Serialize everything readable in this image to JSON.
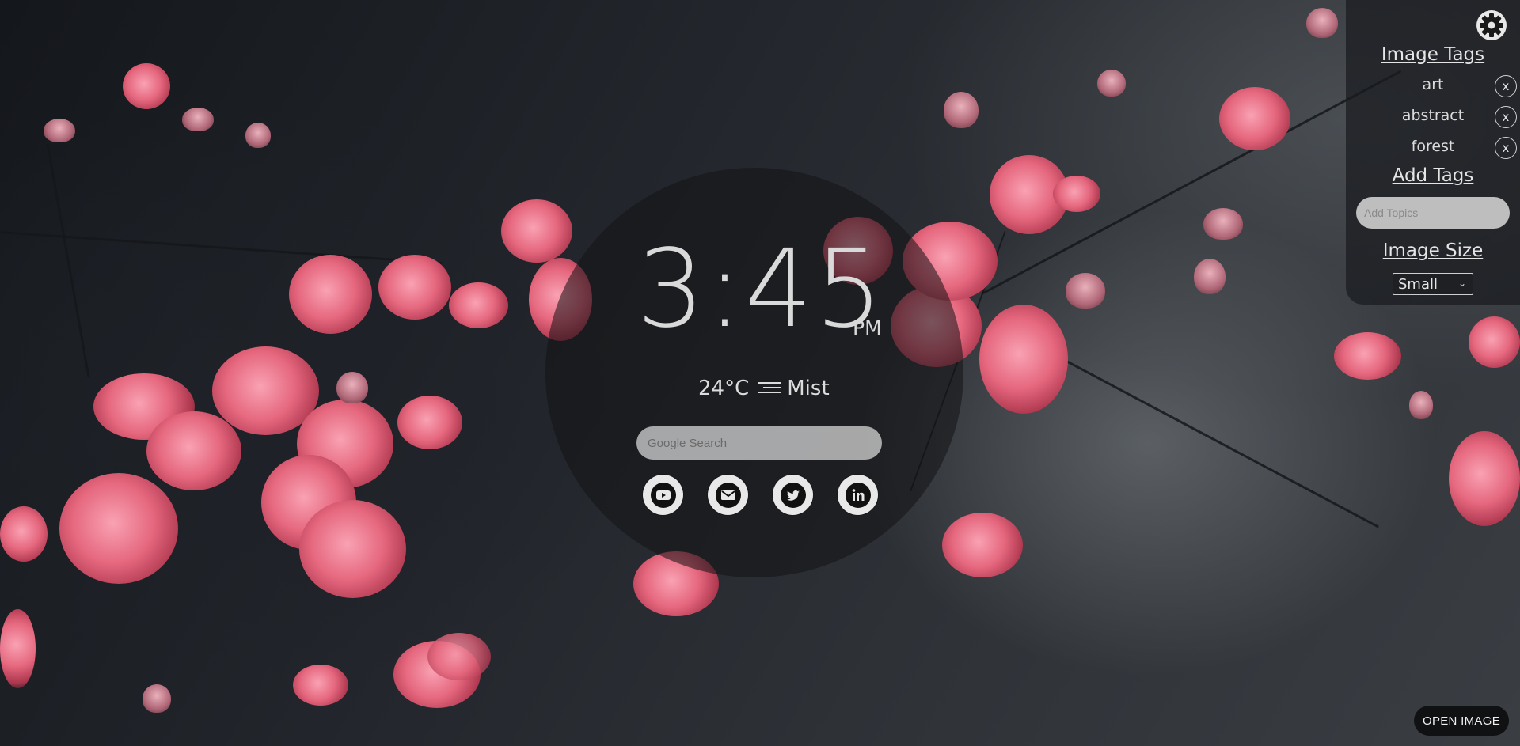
{
  "clock": {
    "time": "3:45",
    "ampm": "PM"
  },
  "weather": {
    "temperature": "24°C",
    "condition": "Mist",
    "icon": "mist-icon"
  },
  "search": {
    "placeholder": "Google Search"
  },
  "socials": [
    {
      "name": "YouTube",
      "icon": "youtube-icon"
    },
    {
      "name": "Mail",
      "icon": "mail-icon"
    },
    {
      "name": "Twitter",
      "icon": "twitter-icon"
    },
    {
      "name": "LinkedIn",
      "icon": "linkedin-icon"
    }
  ],
  "panel": {
    "settings_icon": "gear-icon",
    "image_tags_heading": "Image Tags",
    "tags": [
      {
        "label": "art",
        "remove": "x"
      },
      {
        "label": "abstract",
        "remove": "x"
      },
      {
        "label": "forest",
        "remove": "x"
      }
    ],
    "add_tags_heading": "Add Tags",
    "add_topics_placeholder": "Add Topics",
    "image_size_heading": "Image Size",
    "image_size_selected": "Small"
  },
  "open_image_label": "OPEN IMAGE",
  "colors": {
    "flower_pink": "#e1697f",
    "panel_bg": "#191b1e",
    "pill_bg": "#dcdcdc"
  }
}
